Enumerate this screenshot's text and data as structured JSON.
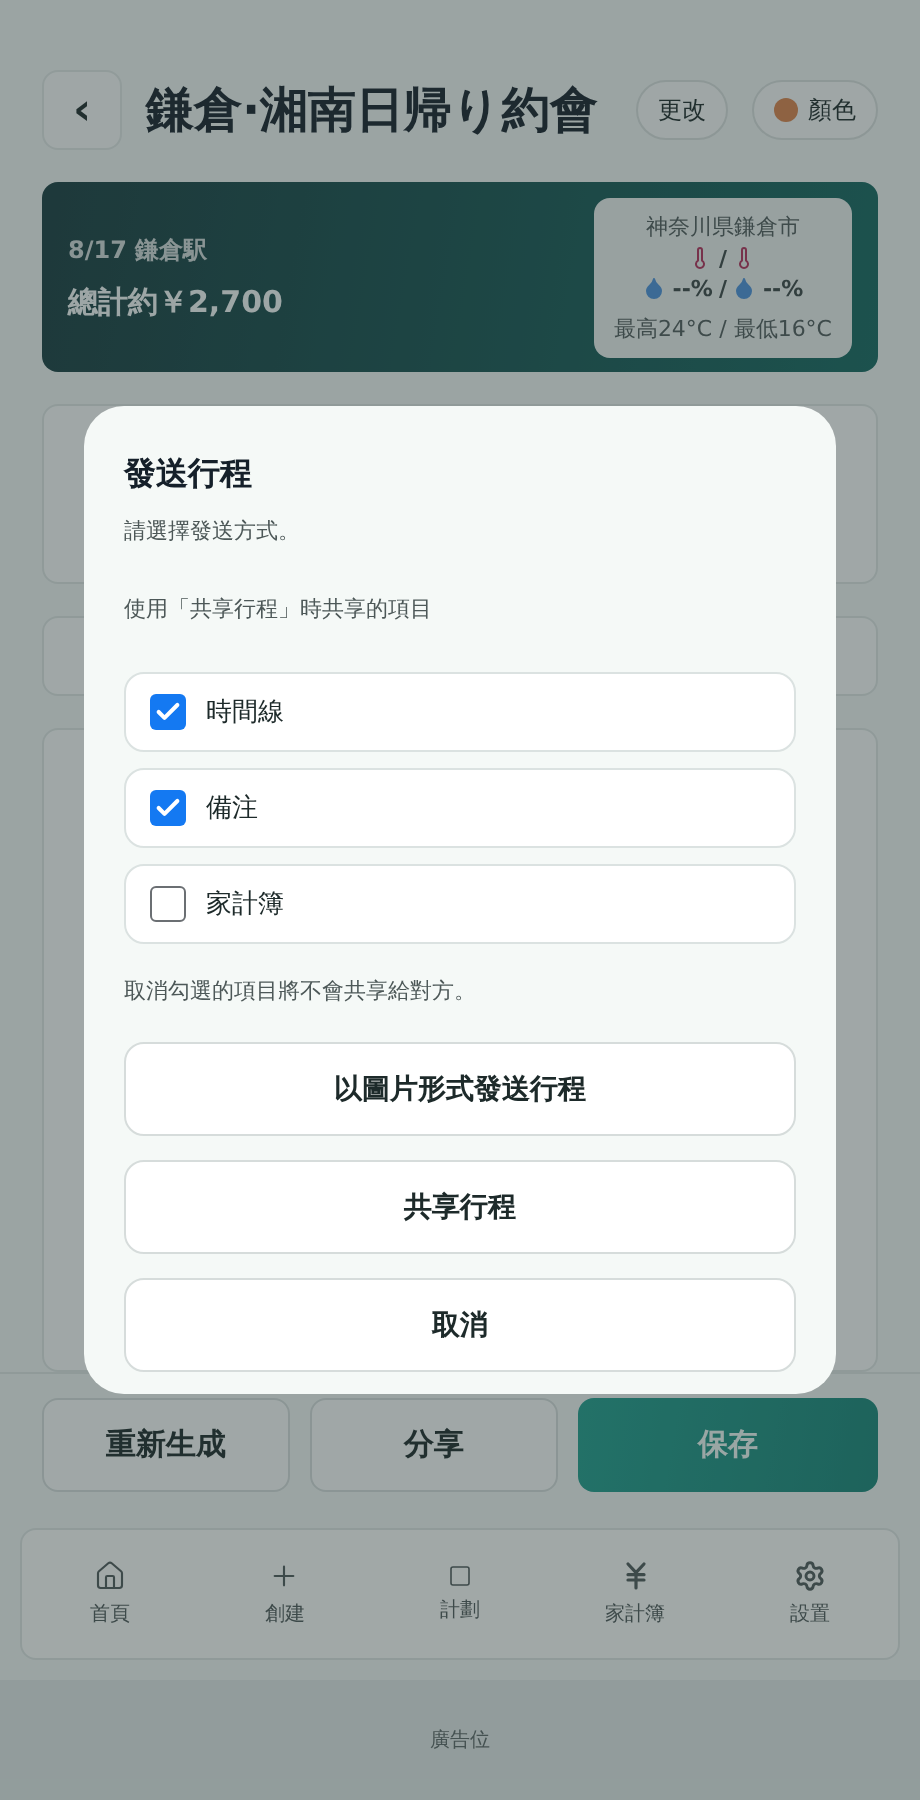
{
  "header": {
    "back": "‹",
    "title": "鎌倉·湘南日帰り約會",
    "edit": "更改",
    "color_button": {
      "label": "顏色",
      "color": "#8e6242"
    }
  },
  "summary": {
    "date_place": "8/17 鎌倉駅",
    "total": "總計約￥2,700",
    "weather": {
      "location": "神奈川県鎌倉市",
      "temp_sep": "/",
      "humidity": [
        "--%",
        "--%"
      ],
      "humidity_sep": "/",
      "range": "最高24°C / 最低16°C"
    }
  },
  "actions": [
    {
      "label": "重新生成",
      "primary": false
    },
    {
      "label": "分享",
      "primary": false
    },
    {
      "label": "保存",
      "primary": true
    }
  ],
  "nav": [
    {
      "label": "首頁",
      "kind": "home"
    },
    {
      "label": "創建",
      "kind": "create"
    },
    {
      "label": "計劃",
      "kind": "plan"
    },
    {
      "label": "家計簿",
      "kind": "budget"
    },
    {
      "label": "設置",
      "kind": "settings"
    }
  ],
  "ad": "廣告位",
  "dialog": {
    "title": "發送行程",
    "subtitle": "請選擇發送方式。",
    "section": "使用「共享行程」時共享的項目",
    "options": [
      {
        "label": "時間線",
        "checked": true
      },
      {
        "label": "備注",
        "checked": true
      },
      {
        "label": "家計簿",
        "checked": false
      }
    ],
    "note": "取消勾選的項目將不會共享給對方。",
    "buttons": [
      "以圖片形式發送行程",
      "共享行程",
      "取消"
    ]
  }
}
